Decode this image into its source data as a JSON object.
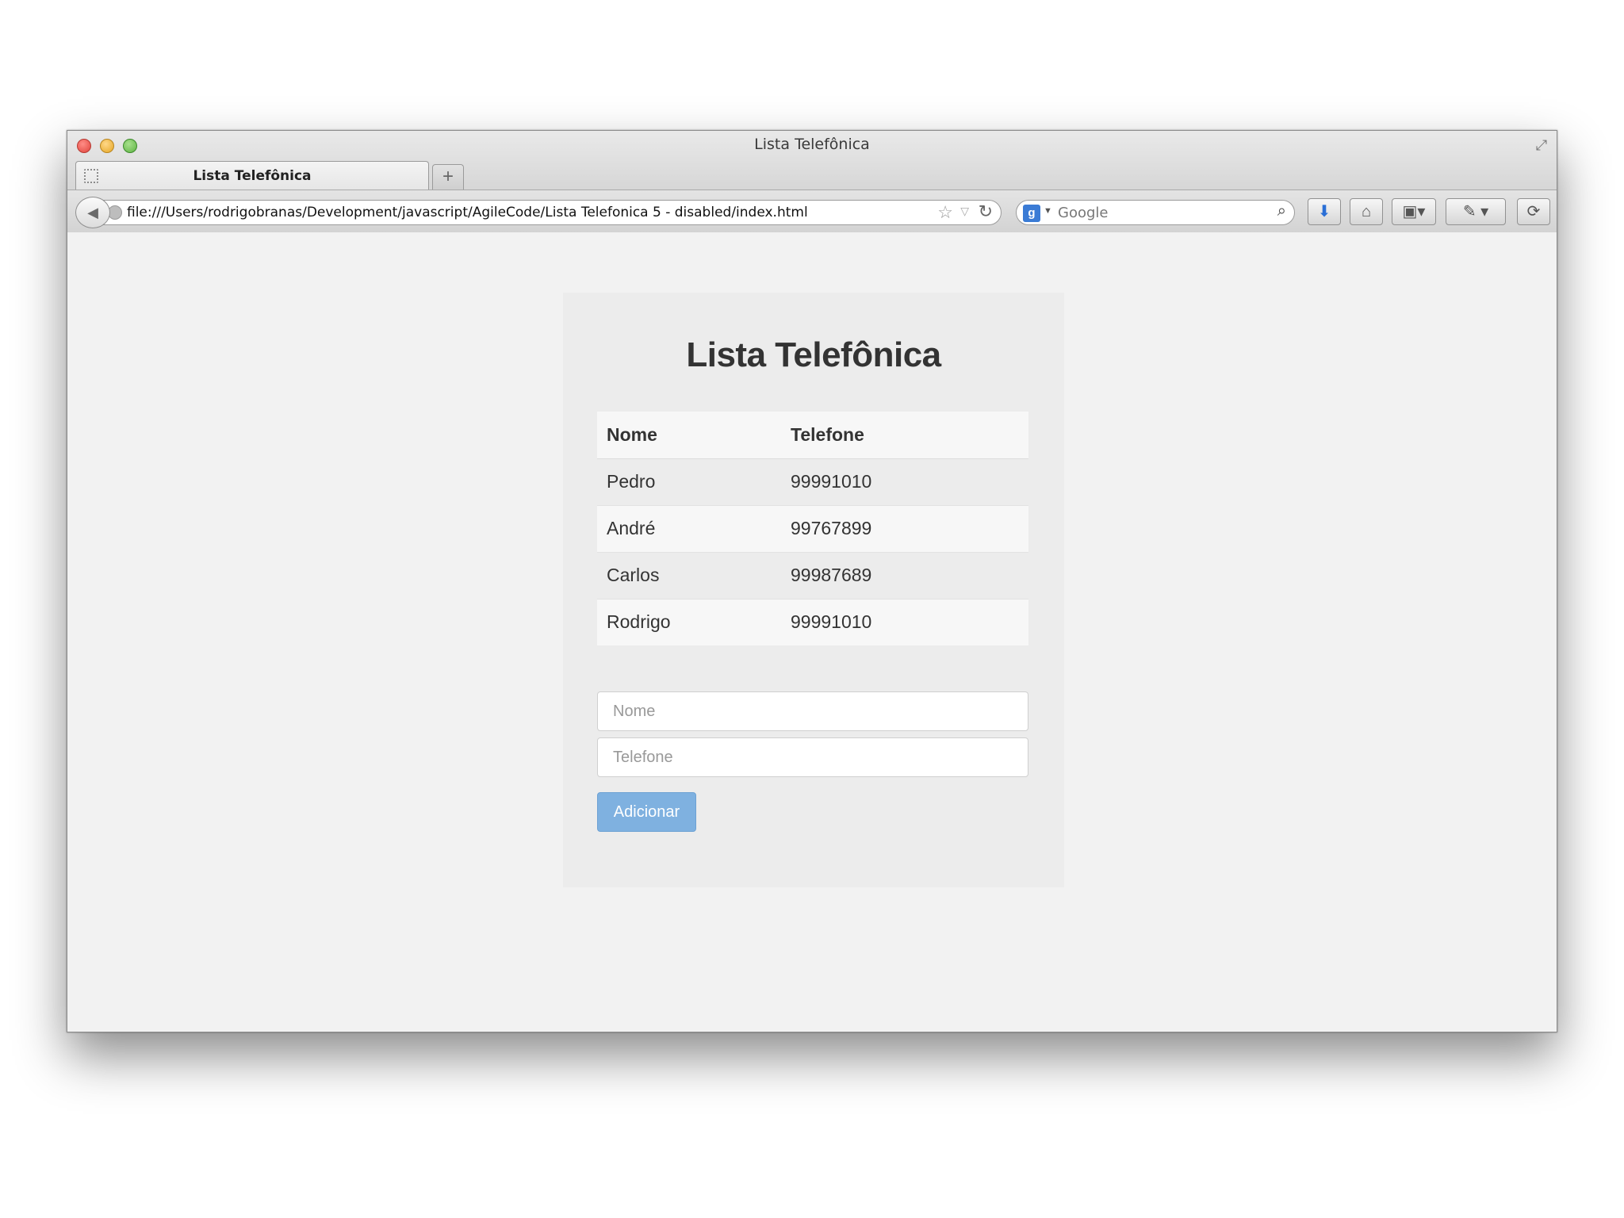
{
  "window": {
    "title": "Lista Telefônica"
  },
  "tabs": [
    {
      "label": "Lista Telefônica"
    }
  ],
  "newtab_label": "+",
  "navbar": {
    "url": "file:///Users/rodrigobranas/Development/javascript/AgileCode/Lista Telefonica 5 - disabled/index.html",
    "search_placeholder": "Google"
  },
  "page": {
    "title": "Lista Telefônica",
    "table": {
      "headers": [
        "Nome",
        "Telefone"
      ],
      "rows": [
        [
          "Pedro",
          "99991010"
        ],
        [
          "André",
          "99767899"
        ],
        [
          "Carlos",
          "99987689"
        ],
        [
          "Rodrigo",
          "99991010"
        ]
      ]
    },
    "form": {
      "name_placeholder": "Nome",
      "phone_placeholder": "Telefone",
      "add_label": "Adicionar",
      "add_disabled": true
    }
  },
  "colors": {
    "button": "#7fb1e0",
    "panel": "#ececec",
    "page_bg": "#f2f2f2"
  }
}
